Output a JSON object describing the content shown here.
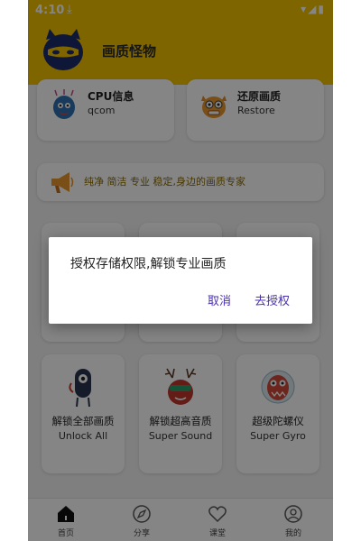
{
  "status": {
    "time": "4:10",
    "download_icon": "download-icon",
    "wifi_icon": "wifi-icon",
    "signal_icon": "signal-icon",
    "battery_icon": "battery-icon"
  },
  "header": {
    "title": "画质怪物",
    "logo_icon": "monster-logo-icon"
  },
  "info_cards": [
    {
      "title": "CPU信息",
      "value": "qcom",
      "icon": "cpu-monster-icon"
    },
    {
      "title": "还原画质",
      "value": "Restore",
      "icon": "restore-monster-icon"
    }
  ],
  "banner": {
    "text": "纯净 简洁 专业 稳定,身边的画质专家",
    "icon": "megaphone-icon"
  },
  "features": [
    {
      "title": "解锁全部画质",
      "subtitle": "Unlock All",
      "icon": "unlock-monster-icon"
    },
    {
      "title": "解锁超高音质",
      "subtitle": "Super Sound",
      "icon": "sound-monster-icon"
    },
    {
      "title": "超级陀螺仪",
      "subtitle": "Super Gyro",
      "icon": "gyro-monster-icon"
    }
  ],
  "nav": [
    {
      "label": "首页",
      "icon": "home-icon"
    },
    {
      "label": "分享",
      "icon": "compass-icon"
    },
    {
      "label": "课堂",
      "icon": "heart-icon"
    },
    {
      "label": "我的",
      "icon": "profile-icon"
    }
  ],
  "dialog": {
    "message": "授权存储权限,解锁专业画质",
    "cancel": "取消",
    "confirm": "去授权"
  },
  "colors": {
    "brand": "#f2c100",
    "dialog_button": "#4b2fb3",
    "banner_text": "#8a6a00"
  }
}
